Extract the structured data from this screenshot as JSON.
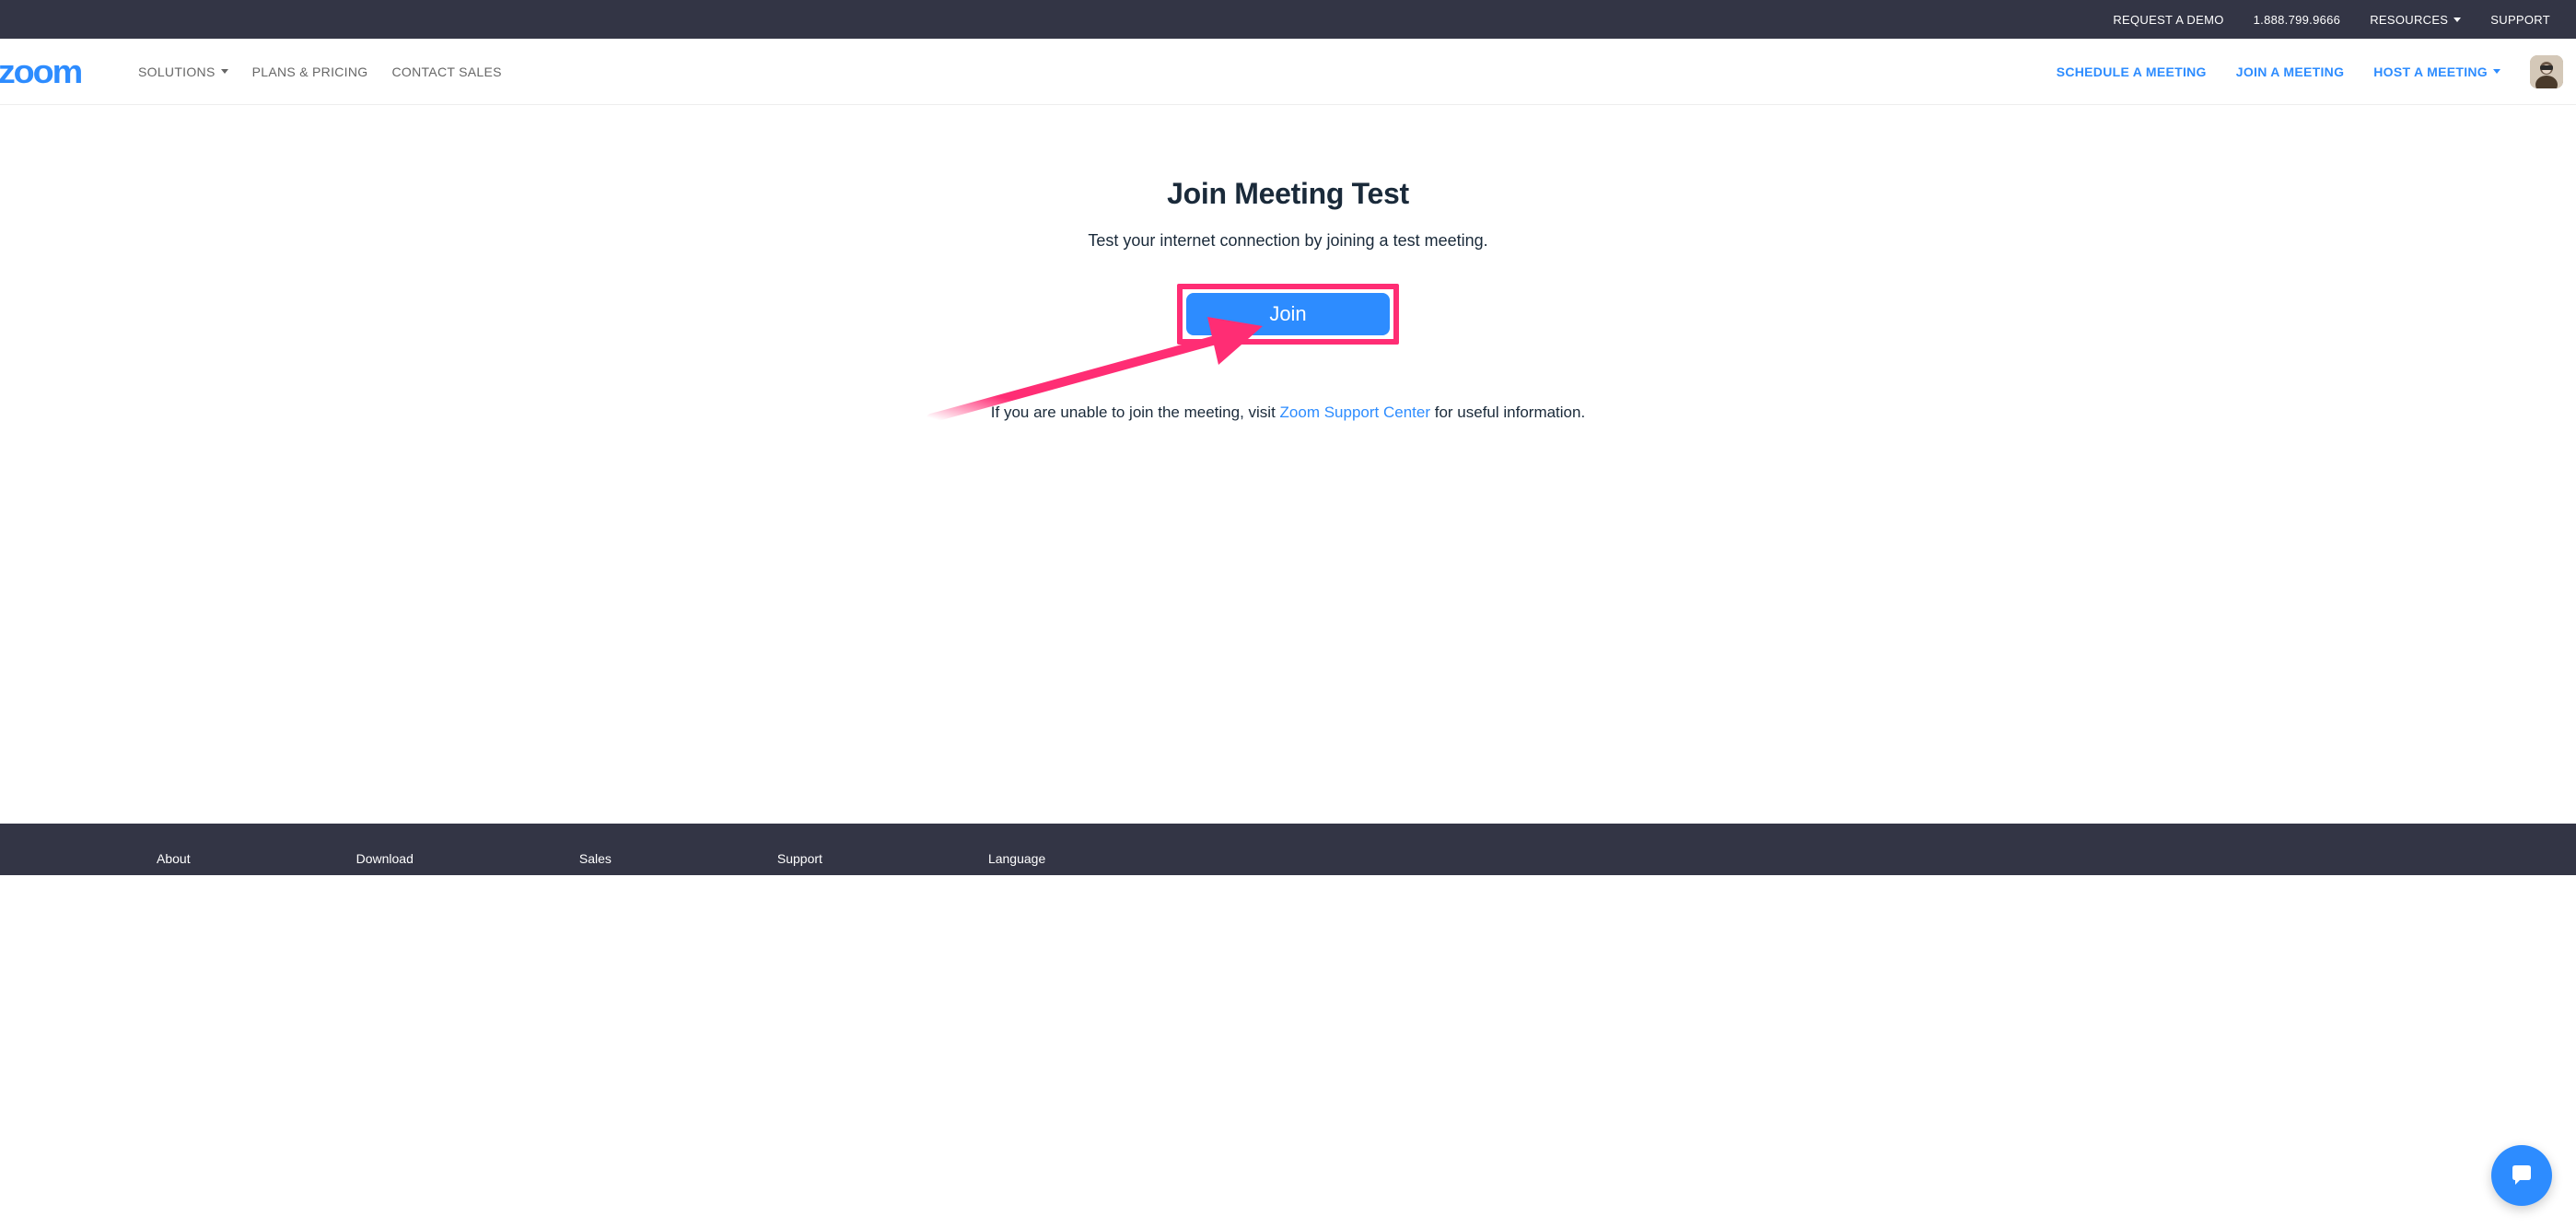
{
  "topbar": {
    "request_demo": "REQUEST A DEMO",
    "phone": "1.888.799.9666",
    "resources": "RESOURCES",
    "support": "SUPPORT"
  },
  "nav": {
    "logo": "zoom",
    "left": {
      "solutions": "SOLUTIONS",
      "plans": "PLANS & PRICING",
      "contact": "CONTACT SALES"
    },
    "right": {
      "schedule": "SCHEDULE A MEETING",
      "join": "JOIN A MEETING",
      "host": "HOST A MEETING"
    }
  },
  "main": {
    "title": "Join Meeting Test",
    "subtitle": "Test your internet connection by joining a test meeting.",
    "join_label": "Join",
    "help_prefix": "If you are unable to join the meeting, visit ",
    "help_link": "Zoom Support Center",
    "help_suffix": " for useful information."
  },
  "footer": {
    "about": "About",
    "download": "Download",
    "sales": "Sales",
    "support": "Support",
    "language": "Language"
  }
}
